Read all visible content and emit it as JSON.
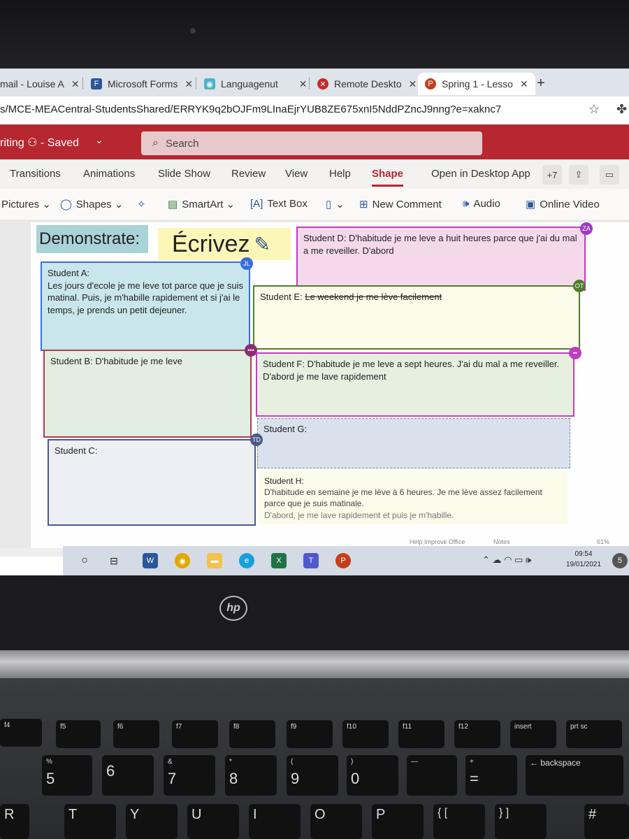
{
  "browser": {
    "tabs": [
      {
        "label": "mail - Louise A",
        "icon": "outlook-icon"
      },
      {
        "label": "Microsoft Forms",
        "icon": "forms-icon"
      },
      {
        "label": "Languagenut",
        "icon": "languagenut-icon"
      },
      {
        "label": "Remote Deskto",
        "icon": "remote-desktop-icon"
      },
      {
        "label": "Spring 1 - Lesso",
        "icon": "powerpoint-icon",
        "active": true
      }
    ],
    "new_tab": "+",
    "url": "s/MCE-MEACentral-StudentsShared/ERRYK9q2bOJFm9LInaEjrYUB8ZE675xnI5NddPZncJ9nng?e=xaknc7"
  },
  "office": {
    "doc_title": "riting",
    "saved": "- Saved",
    "search_placeholder": "Search"
  },
  "ribbon": {
    "tabs": [
      "Transitions",
      "Animations",
      "Slide Show",
      "Review",
      "View",
      "Help",
      "Shape"
    ],
    "open_desktop": "Open in Desktop App",
    "collab_count": "+7"
  },
  "toolbar": {
    "pictures": "Pictures",
    "shapes": "Shapes",
    "smartart": "SmartArt",
    "textbox": "Text Box",
    "new_comment": "New Comment",
    "audio": "Audio",
    "online_video": "Online Video"
  },
  "slide": {
    "demonstrate": "Demonstrate:",
    "ecrivez": "Écrivez",
    "student_a_title": "Student A:",
    "student_a_text": "Les jours d'ecole je me leve tot parce que je suis matinal. Puis, je m'habille rapidement et si j'ai le temps, je prends un petit dejeuner.",
    "student_b": "Student B: D'habitude je me leve",
    "student_c": "Student C:",
    "student_d": "Student D: D'habitude je me leve a huit heures parce que j'ai du mal a me reveiller. D'abord",
    "student_e_label": "Student E:",
    "student_e_text": "Le weekend je me lève facilement",
    "student_f": "Student F: D'habitude je me leve a sept heures. J'ai du mal a me reveiller. D'abord je me lave rapidement",
    "student_g": "Student G:",
    "student_h_title": "Student H:",
    "student_h_line1": "D'habitude en semaine je me lève à 6 heures. Je me lève assez facilement parce que je suis matinale.",
    "student_h_line2": "D'abord, je me lave rapidement et puis je m'habille.",
    "badges": {
      "a": "JL",
      "d": "ZA",
      "e": "OT",
      "c": "TD"
    }
  },
  "status": {
    "help": "Help Improve Office",
    "notes": "Notes",
    "zoom": "61%"
  },
  "taskbar": {
    "time": "09:54",
    "date": "19/01/2021",
    "notif": "5"
  },
  "keyboard": {
    "fkeys": [
      "f4",
      "f5",
      "f6",
      "f7",
      "f8",
      "f9",
      "f10",
      "f11",
      "f12",
      "insert",
      "prt sc"
    ],
    "row_top": [
      [
        "%",
        "5"
      ],
      [
        "",
        "6"
      ],
      [
        "&",
        "7"
      ],
      [
        "*",
        "8"
      ],
      [
        "(",
        "9"
      ],
      [
        ")",
        "0"
      ],
      [
        "—",
        ""
      ],
      [
        "+",
        "="
      ],
      [
        "←",
        "backspace"
      ]
    ],
    "row_letters": [
      "R",
      "T",
      "Y",
      "U",
      "I",
      "O",
      "P",
      "{ [",
      "} ]",
      "#"
    ],
    "brand": "hp"
  }
}
